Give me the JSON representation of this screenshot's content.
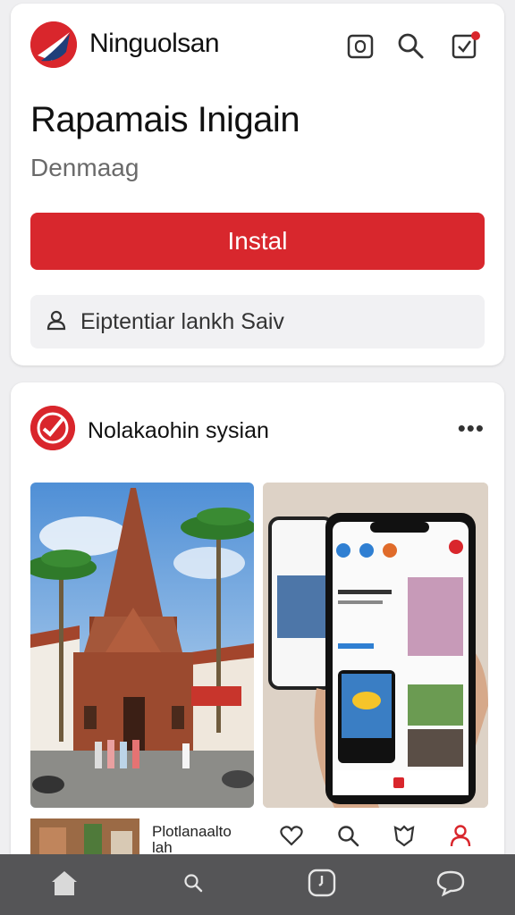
{
  "header": {
    "brand_name": "Ninguolsan",
    "icons": [
      "camera-icon",
      "search-icon",
      "edit-icon"
    ]
  },
  "app": {
    "title": "Rapamais Inigain",
    "subtitle": "Denmaag",
    "install_label": "Instal",
    "search_text": "Eiptentiar lankh Saiv"
  },
  "post": {
    "author": "Nolakaohin sysian",
    "more_label": "•••",
    "caption": "Plotlanaalto lah\nbonnakho ha"
  },
  "colors": {
    "accent": "#d8272d",
    "nav_bar": "#555557"
  },
  "actions": [
    "heart-icon",
    "search-icon",
    "shield-icon",
    "profile-icon"
  ],
  "nav": [
    "home-icon",
    "search-icon",
    "clock-icon",
    "chat-icon"
  ]
}
